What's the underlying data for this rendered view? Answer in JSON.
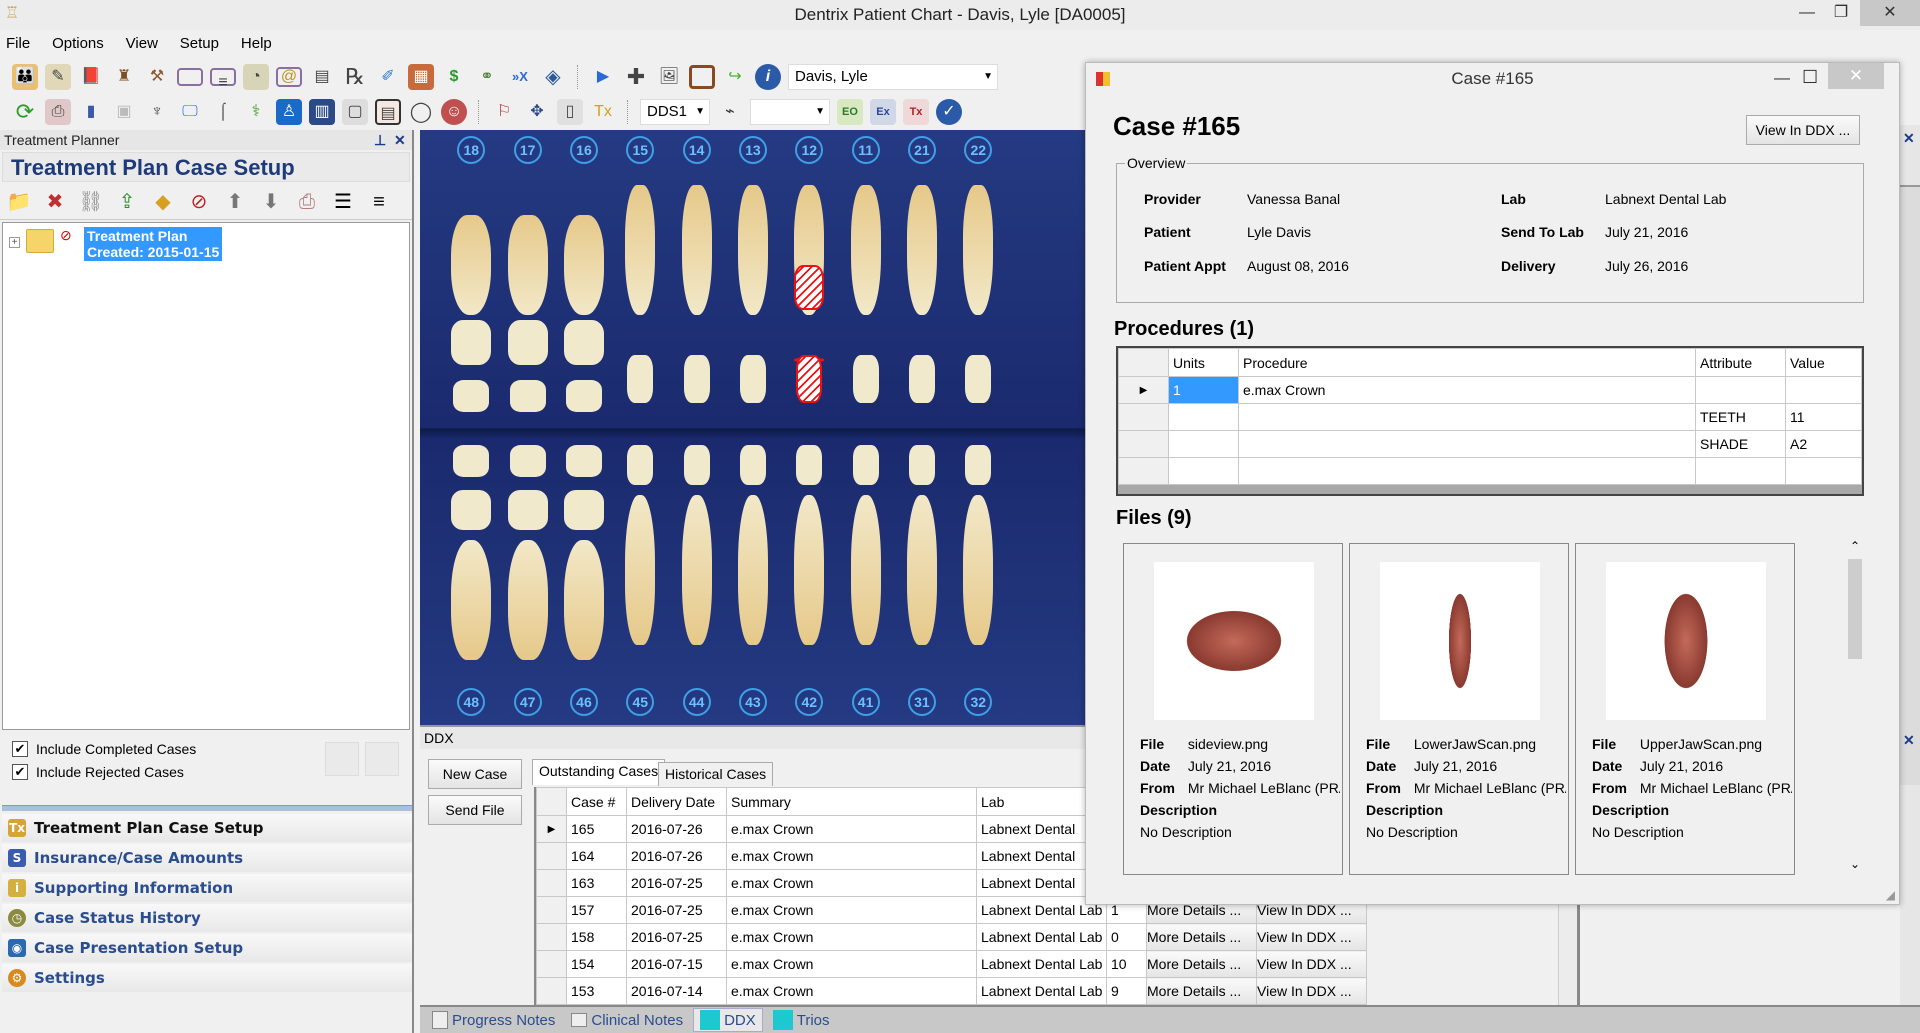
{
  "window": {
    "title": "Dentrix Patient Chart - Davis, Lyle [DA0005]",
    "controls": {
      "minimize": "—",
      "maximize": "❐",
      "close": "✕"
    }
  },
  "menu": [
    "File",
    "Options",
    "View",
    "Setup",
    "Help"
  ],
  "toolbar": {
    "row1_icons": [
      "family-file-icon",
      "notes-icon",
      "ledger-book-icon",
      "office-chair-icon",
      "perio-icon",
      "card-icon",
      "note-card-icon",
      "document-center-icon",
      "email-icon",
      "forms-icon",
      "prescription-icon",
      "quick-letter-icon",
      "file-cabinet-icon",
      "dollar-icon",
      "glasses-icon",
      "ddx-icon",
      "cube-icon",
      "patient-arrow-icon",
      "medical-cross-icon",
      "patient-picture-icon",
      "patient-frame-icon",
      "recycle-tooth-icon",
      "info-icon"
    ],
    "patient_combo": "Davis, Lyle",
    "row2_icons": [
      "refresh-icon",
      "printer-icon",
      "chart-icon",
      "xray-icon",
      "tooth-rotate-icon",
      "monitor-pen-icon",
      "instrument-icon",
      "treatment-chair-icon",
      "tooth-monitor-icon",
      "tooth-image-icon",
      "notepad-icon",
      "chart-view-icon",
      "arch-icon",
      "dentures-icon",
      "tooth-drill-icon",
      "move-tooth-icon",
      "notepad2-icon",
      "tx-plan-icon",
      "scanner-icon",
      "eo-icon",
      "ex-icon",
      "tx-icon",
      "check-icon"
    ],
    "provider_combo": "DDS1",
    "status_combo": ""
  },
  "left_panel": {
    "header": "Treatment Planner",
    "pin": "⊥",
    "close": "✕",
    "title": "Treatment Plan Case Setup",
    "tree": {
      "node_line1": "Treatment Plan",
      "node_line2": "Created: 2015-01-15"
    },
    "checkboxes": [
      {
        "label": "Include Completed Cases",
        "checked": true
      },
      {
        "label": "Include Rejected Cases",
        "checked": true
      }
    ],
    "nav": [
      {
        "label": "Treatment Plan Case Setup",
        "icon": "tx-icon",
        "color": "#d8a23a"
      },
      {
        "label": "Insurance/Case Amounts",
        "icon": "insurance-icon",
        "color": "#3a5cb0"
      },
      {
        "label": "Supporting Information",
        "icon": "info-folder-icon",
        "color": "#d4b040"
      },
      {
        "label": "Case Status History",
        "icon": "clock-icon",
        "color": "#8a8a40"
      },
      {
        "label": "Case Presentation Setup",
        "icon": "presentation-icon",
        "color": "#2a6ab0"
      },
      {
        "label": "Settings",
        "icon": "gear-icon",
        "color": "#d88a20"
      }
    ]
  },
  "tooth_chart": {
    "upper_numbers": [
      "18",
      "17",
      "16",
      "15",
      "14",
      "13",
      "12",
      "11",
      "21",
      "22"
    ],
    "lower_numbers": [
      "48",
      "47",
      "46",
      "45",
      "44",
      "43",
      "42",
      "41",
      "31",
      "32"
    ],
    "marked_tooth": "12"
  },
  "ddx": {
    "title": "DDX",
    "new_case": "New Case",
    "send_file": "Send File",
    "tabs": [
      "Outstanding Cases",
      "Historical Cases"
    ],
    "columns": [
      "Case #",
      "Delivery Date",
      "Summary",
      "Lab"
    ],
    "rows": [
      {
        "case": "165",
        "date": "2016-07-26",
        "summary": "e.max Crown",
        "lab": "Labnext Dental",
        "extra": "",
        "selected": true
      },
      {
        "case": "164",
        "date": "2016-07-26",
        "summary": "e.max Crown",
        "lab": "Labnext Dental",
        "extra": ""
      },
      {
        "case": "163",
        "date": "2016-07-25",
        "summary": "e.max Crown",
        "lab": "Labnext Dental",
        "extra": ""
      },
      {
        "case": "157",
        "date": "2016-07-25",
        "summary": "e.max Crown",
        "lab": "Labnext Dental Lab",
        "extra": "1"
      },
      {
        "case": "158",
        "date": "2016-07-25",
        "summary": "e.max Crown",
        "lab": "Labnext Dental Lab",
        "extra": "0"
      },
      {
        "case": "154",
        "date": "2016-07-15",
        "summary": "e.max Crown",
        "lab": "Labnext Dental Lab",
        "extra": "10"
      },
      {
        "case": "153",
        "date": "2016-07-14",
        "summary": "e.max Crown",
        "lab": "Labnext Dental Lab",
        "extra": "9"
      }
    ],
    "more_details": "More Details ...",
    "view_in_ddx": "View In DDX ..."
  },
  "bottom_tabs": [
    "Progress Notes",
    "Clinical Notes",
    "DDX",
    "Trios"
  ],
  "dialog": {
    "title": "Case #165",
    "heading": "Case #165",
    "view_in_ddx": "View In DDX ...",
    "overview": {
      "legend": "Overview",
      "provider_label": "Provider",
      "provider": "Vanessa Banal",
      "patient_label": "Patient",
      "patient": "Lyle Davis",
      "appt_label": "Patient Appt",
      "appt": "August 08, 2016",
      "lab_label": "Lab",
      "lab": "Labnext Dental Lab",
      "send_label": "Send To Lab",
      "send": "July 21, 2016",
      "delivery_label": "Delivery",
      "delivery": "July 26, 2016"
    },
    "procedures_title": "Procedures (1)",
    "proc_columns": [
      "Units",
      "Procedure",
      "Attribute",
      "Value"
    ],
    "proc_rows": [
      {
        "units": "1",
        "procedure": "e.max Crown",
        "attribute": "",
        "value": ""
      },
      {
        "units": "",
        "procedure": "",
        "attribute": "TEETH",
        "value": "11"
      },
      {
        "units": "",
        "procedure": "",
        "attribute": "SHADE",
        "value": "A2"
      },
      {
        "units": "",
        "procedure": "",
        "attribute": "",
        "value": ""
      }
    ],
    "files_title": "Files (9)",
    "file_labels": {
      "file": "File",
      "date": "Date",
      "from": "From",
      "description": "Description"
    },
    "files": [
      {
        "name": "sideview.png",
        "date": "July 21, 2016",
        "from": "Mr Michael LeBlanc (PRA",
        "description": "No Description"
      },
      {
        "name": "LowerJawScan.png",
        "date": "July 21, 2016",
        "from": "Mr Michael LeBlanc (PRA",
        "description": "No Description"
      },
      {
        "name": "UpperJawScan.png",
        "date": "July 21, 2016",
        "from": "Mr Michael LeBlanc (PRA",
        "description": "No Description"
      }
    ]
  }
}
